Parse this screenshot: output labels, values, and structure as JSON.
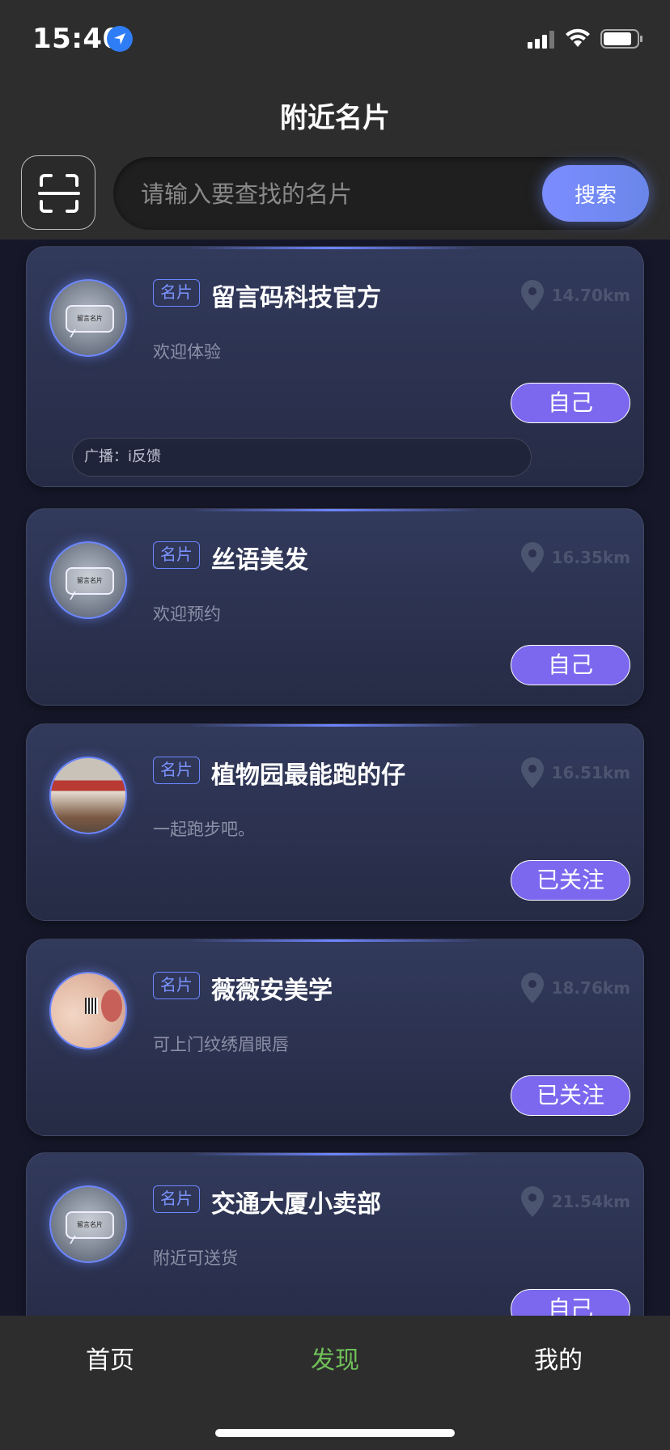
{
  "status_bar": {
    "time": "15:40",
    "icons": [
      "location-arrow-icon",
      "signal-icon",
      "wifi-icon",
      "battery-icon"
    ]
  },
  "header": {
    "title": "附近名片"
  },
  "search": {
    "placeholder": "请输入要查找的名片",
    "value": "",
    "button_label": "搜索",
    "scan_icon": "scan-icon"
  },
  "cards": [
    {
      "tag": "名片",
      "name": "留言码科技官方",
      "distance": "14.70km",
      "desc": "欢迎体验",
      "action": "自己",
      "broadcast": "广播：i反馈",
      "avatar": "logo"
    },
    {
      "tag": "名片",
      "name": "丝语美发",
      "distance": "16.35km",
      "desc": "欢迎预约",
      "action": "自己",
      "avatar": "logo"
    },
    {
      "tag": "名片",
      "name": "植物园最能跑的仔",
      "distance": "16.51km",
      "desc": "一起跑步吧。",
      "action": "已关注",
      "avatar": "shop"
    },
    {
      "tag": "名片",
      "name": "薇薇安美学",
      "distance": "18.76km",
      "desc": "可上门纹绣眉眼唇",
      "action": "已关注",
      "avatar": "face"
    },
    {
      "tag": "名片",
      "name": "交通大厦小卖部",
      "distance": "21.54km",
      "desc": "附近可送货",
      "action": "自己",
      "avatar": "logo"
    }
  ],
  "avatar_logo_text": "留言名片",
  "tabs": {
    "home": "首页",
    "discover": "发现",
    "mine": "我的",
    "active": "discover"
  },
  "colors": {
    "accent": "#7b68ee",
    "search_button": "#7c8dff",
    "active_tab": "#6fbf58",
    "card_bg": "#2c3250"
  }
}
